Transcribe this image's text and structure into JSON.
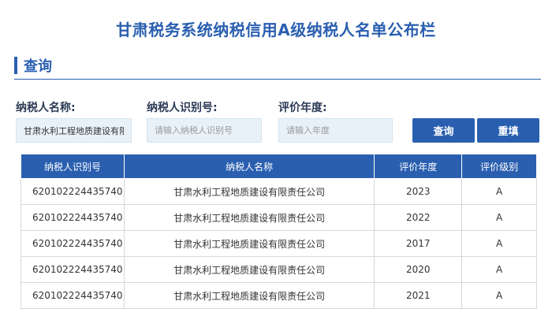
{
  "page": {
    "title": "甘肃税务系统纳税信用A级纳税人名单公布栏"
  },
  "section": {
    "title": "查询"
  },
  "search": {
    "name_label": "纳税人名称:",
    "name_value": "甘肃水利工程地质建设有限责",
    "id_label": "纳税人识别号:",
    "id_placeholder": "请输入纳税人识别号",
    "year_label": "评价年度:",
    "year_placeholder": "请输入年度",
    "query_button": "查询",
    "reset_button": "重填"
  },
  "table": {
    "columns": [
      "纳税人识别号",
      "纳税人名称",
      "评价年度",
      "评价级别"
    ],
    "rows": [
      [
        "620102224435740",
        "甘肃水利工程地质建设有限责任公司",
        "2023",
        "A"
      ],
      [
        "620102224435740",
        "甘肃水利工程地质建设有限责任公司",
        "2022",
        "A"
      ],
      [
        "620102224435740",
        "甘肃水利工程地质建设有限责任公司",
        "2017",
        "A"
      ],
      [
        "620102224435740",
        "甘肃水利工程地质建设有限责任公司",
        "2020",
        "A"
      ],
      [
        "620102224435740",
        "甘肃水利工程地质建设有限责任公司",
        "2021",
        "A"
      ]
    ]
  },
  "colors": {
    "accent": "#2a5fb0",
    "input_bg": "#e8f1f8"
  }
}
